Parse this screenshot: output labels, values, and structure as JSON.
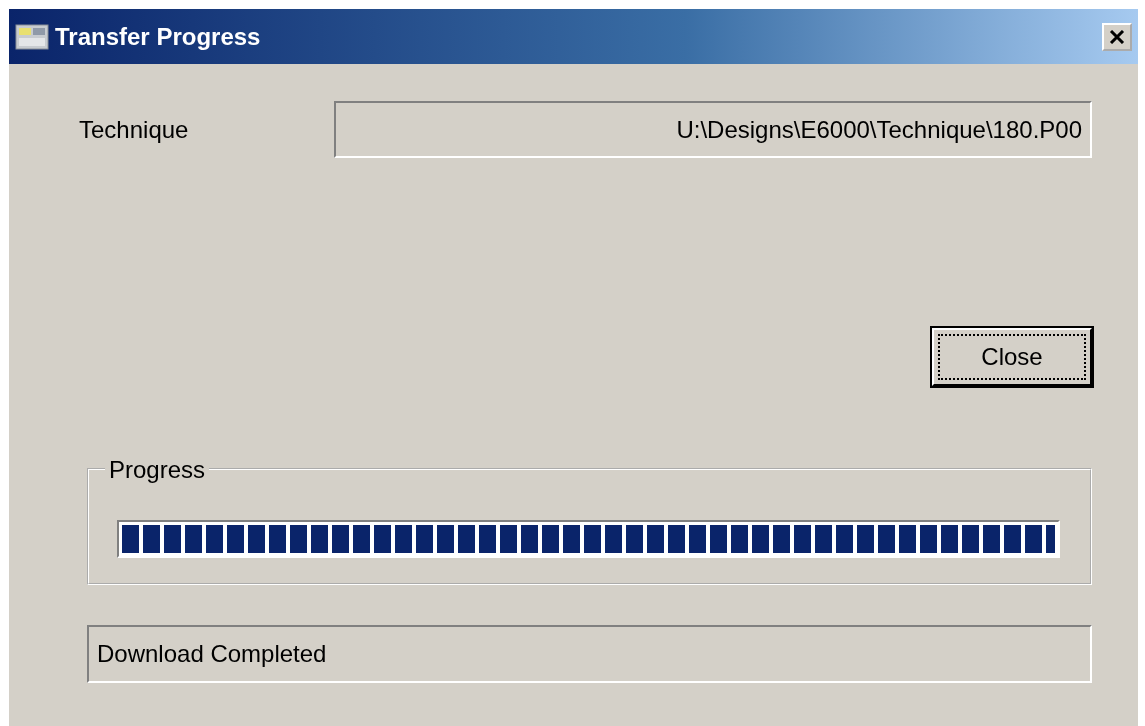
{
  "window": {
    "title": "Transfer Progress"
  },
  "technique": {
    "label": "Technique",
    "value": "U:\\Designs\\E6000\\Technique\\180.P00"
  },
  "close_button": {
    "label": "Close"
  },
  "progress": {
    "title": "Progress",
    "level": 1
  },
  "status": {
    "value": "Download Completed"
  }
}
